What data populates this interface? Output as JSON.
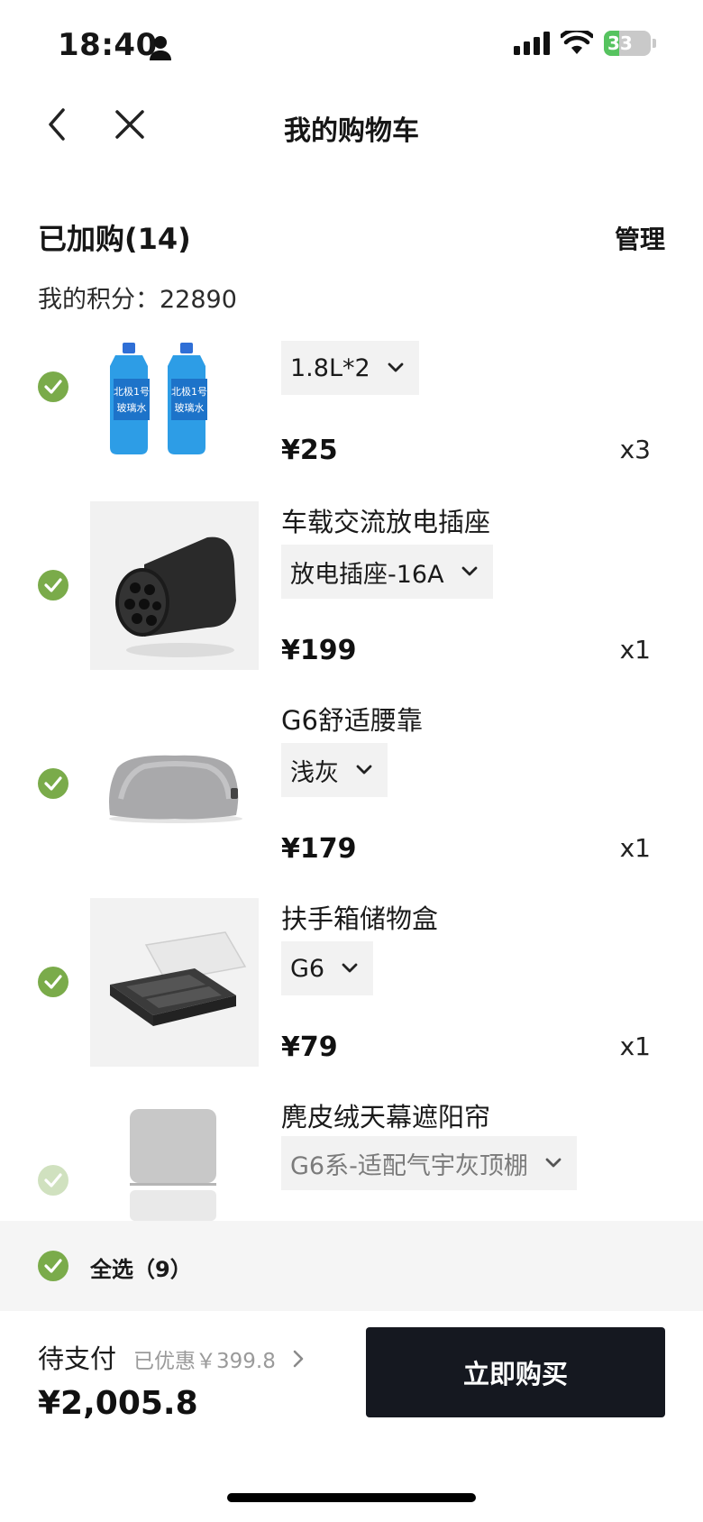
{
  "status_bar": {
    "time": "18:40",
    "battery": "33",
    "battery_level": 0.33
  },
  "nav": {
    "title": "我的购物车"
  },
  "cart": {
    "heading": "已加购(14)",
    "manage": "管理",
    "points_label": "我的积分：",
    "points_value": "22890"
  },
  "items": [
    {
      "name": "",
      "spec": "1.8L*2",
      "price": "¥25",
      "qty": "x3"
    },
    {
      "name": "车载交流放电插座",
      "spec": "放电插座-16A",
      "price": "¥199",
      "qty": "x1"
    },
    {
      "name": "G6舒适腰靠",
      "spec": "浅灰",
      "price": "¥179",
      "qty": "x1"
    },
    {
      "name": "扶手箱储物盒",
      "spec": "G6",
      "price": "¥79",
      "qty": "x1"
    },
    {
      "name": "麂皮绒天幕遮阳帘",
      "spec": "G6系-适配气宇灰顶棚",
      "price": "",
      "qty": ""
    }
  ],
  "product_image_text": {
    "line1": "北极1号",
    "line2": "玻璃水"
  },
  "select_all": {
    "label": "全选（9）"
  },
  "footer": {
    "pay_label": "待支付",
    "discount": "已优惠￥399.8",
    "total": "¥2,005.8",
    "buy_button": "立即购买"
  },
  "colors": {
    "check": "#7aab4a",
    "buy_button": "#151820",
    "select_bar": "#f5f5f5"
  }
}
